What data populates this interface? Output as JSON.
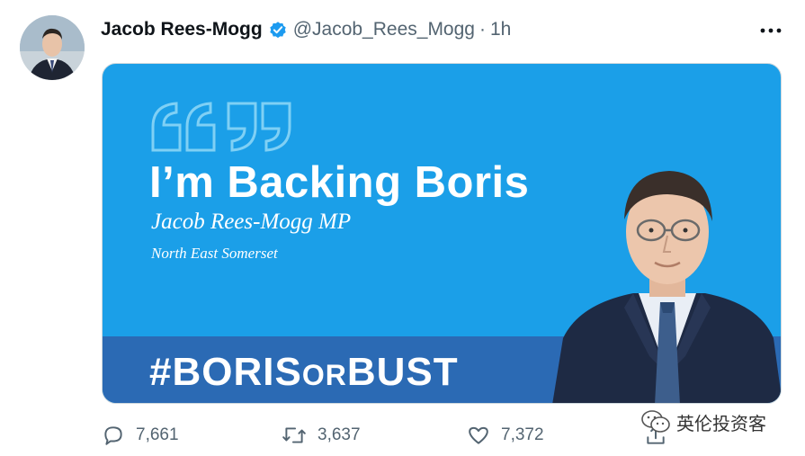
{
  "tweet": {
    "author_name": "Jacob Rees-Mogg",
    "handle": "@Jacob_Rees_Mogg",
    "separator": "·",
    "time": "1h",
    "verified": true
  },
  "card": {
    "headline": "I’m Backing Boris",
    "mp_name": "Jacob Rees-Mogg MP",
    "constituency": "North East Somerset",
    "hashtag_start": "#BORIS",
    "hashtag_mid": "OR",
    "hashtag_end": "BUST",
    "background_color": "#1b9fe8",
    "banner_color": "#2b6ab4"
  },
  "actions": {
    "replies": "7,661",
    "retweets": "3,637",
    "likes": "7,372"
  },
  "watermark": {
    "text": "英伦投资客"
  },
  "icons": [
    "verified-badge-icon",
    "more-icon",
    "reply-icon",
    "retweet-icon",
    "like-icon",
    "share-icon",
    "wechat-icon",
    "quote-icon"
  ],
  "colors": {
    "verified": "#1d9bf0",
    "secondary_text": "#536471"
  }
}
